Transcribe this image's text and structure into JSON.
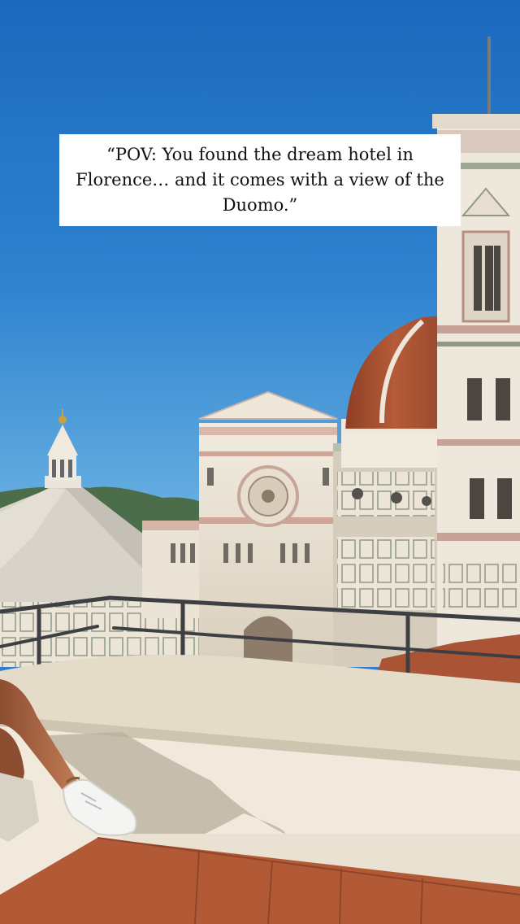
{
  "caption": {
    "text": "“POV: You found the dream hotel in Florence… and it comes with a view of the Duomo.”"
  },
  "colors": {
    "sky_top": "#1f6fc0",
    "sky_bottom": "#5da6df",
    "marble": "#eee6d9",
    "pink_marble": "#d8b2a7",
    "green_marble": "#7e8a7a",
    "dome_terracotta": "#a95232",
    "roof_tile": "#b55a3c",
    "parapet": "#e6ddca",
    "railing": "#3e3f42",
    "caption_bg": "#ffffff",
    "caption_text": "#111111"
  },
  "scene": {
    "subject": "Florence Cathedral (Duomo) with Giotto's bell tower and the Baptistery, seen from a hotel rooftop terrace",
    "icons": [
      "dome",
      "bell-tower",
      "baptistery",
      "terrace-railing",
      "sneaker"
    ]
  }
}
